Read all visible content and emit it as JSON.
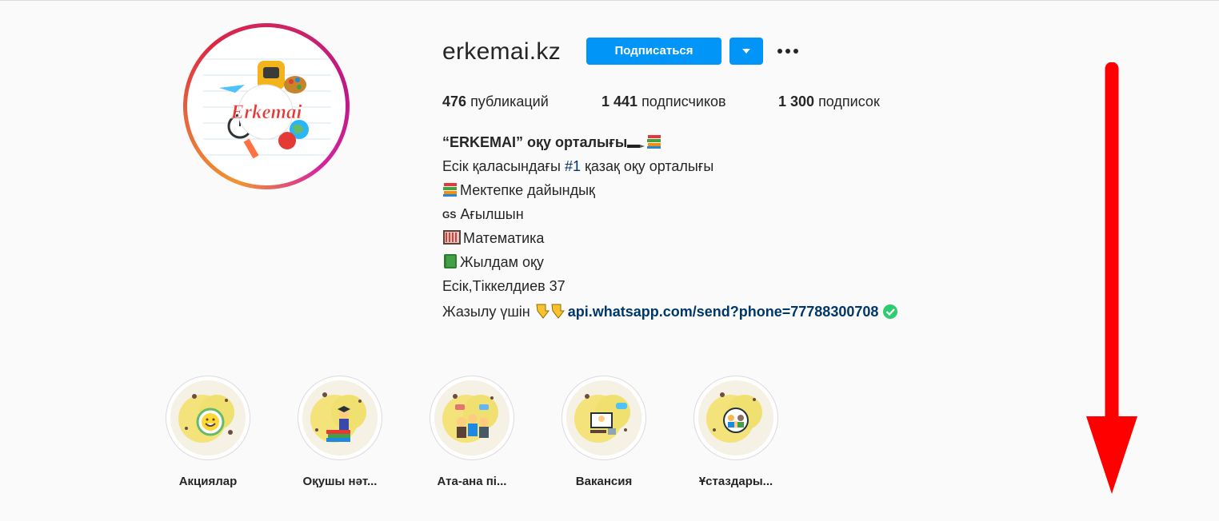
{
  "profile": {
    "username": "erkemai.kz",
    "follow_label": "Подписаться",
    "avatar_logo_text": "Erkemai"
  },
  "stats": [
    {
      "count": "476",
      "label": "публикаций"
    },
    {
      "count": "1 441",
      "label": "подписчиков"
    },
    {
      "count": "1 300",
      "label": "подписок"
    }
  ],
  "bio": {
    "title": "“ERKEMAI” оқу орталығы",
    "line1_pre": "Есік қаласындағы ",
    "line1_hashtag": "#1",
    "line1_post": " қазақ оқу орталығы",
    "line2": "Мектепке дайындық",
    "line3_prefix": "GS",
    "line3": " Ағылшын",
    "line4": "Математика",
    "line5": "Жылдам оқу",
    "line6": "Есік,Тіккелдиев 37",
    "line7_pre": "Жазылу үшін ",
    "line7_link": "api.whatsapp.com/send?phone=77788300708"
  },
  "highlights": [
    {
      "label": "Акциялар",
      "icon": "smiley-chat-icon"
    },
    {
      "label": "Оқушы нәт...",
      "icon": "graduate-books-icon"
    },
    {
      "label": "Ата-ана пі...",
      "icon": "parents-group-icon"
    },
    {
      "label": "Вакансия",
      "icon": "job-interview-icon"
    },
    {
      "label": "Ұстаздары...",
      "icon": "teachers-group-icon"
    }
  ],
  "colors": {
    "accent": "#0095f6",
    "link": "#00376b",
    "arrow": "#ff0000",
    "background": "#fafafa"
  }
}
